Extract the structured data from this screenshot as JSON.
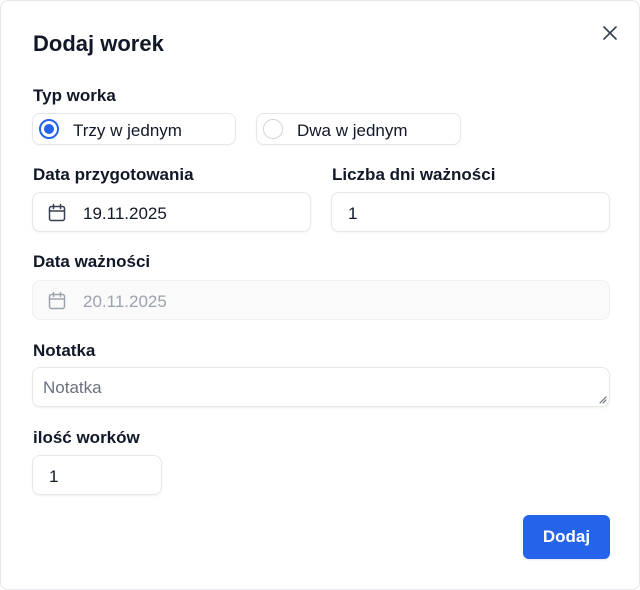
{
  "dialog": {
    "title": "Dodaj worek",
    "close_icon": "close-icon"
  },
  "bag_type": {
    "label": "Typ worka",
    "options": [
      {
        "label": "Trzy w jednym",
        "checked": true
      },
      {
        "label": "Dwa w jednym",
        "checked": false
      }
    ]
  },
  "prep_date": {
    "label": "Data przygotowania",
    "value": "19.11.2025",
    "icon": "calendar-icon"
  },
  "valid_days": {
    "label": "Liczba dni ważności",
    "value": "1"
  },
  "expiry_date": {
    "label": "Data ważności",
    "value": "20.11.2025",
    "icon": "calendar-icon"
  },
  "note": {
    "label": "Notatka",
    "placeholder": "Notatka"
  },
  "bag_count": {
    "label": "ilość worków",
    "value": "1"
  },
  "actions": {
    "submit_label": "Dodaj"
  },
  "colors": {
    "accent": "#2563eb",
    "border": "#e5e7eb",
    "text": "#111827",
    "muted": "#9ca3af"
  }
}
